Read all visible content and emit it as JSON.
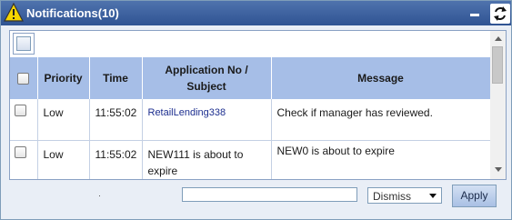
{
  "header": {
    "title": "Notifications(10)",
    "icons": {
      "warning": "warning-icon",
      "minimize": "minimize-icon",
      "refresh": "refresh-icon"
    }
  },
  "table": {
    "columns": [
      "Priority",
      "Time",
      "Application No / Subject",
      "Message"
    ],
    "rows": [
      {
        "priority": "Low",
        "time": "11:55:02",
        "subject": "RetailLending338",
        "message": "Check if manager has reviewed."
      },
      {
        "priority": "Low",
        "time": "11:55:02",
        "subject": "NEW111 is about to expire",
        "message": "NEW0 is about to expire"
      }
    ]
  },
  "footer": {
    "text_value": "",
    "action_selected": "Dismiss",
    "apply_label": "Apply"
  },
  "colors": {
    "titlebar": "#2f5393",
    "header_bg": "#a6bee7",
    "link": "#1c2e8f",
    "warning": "#f5d400"
  }
}
